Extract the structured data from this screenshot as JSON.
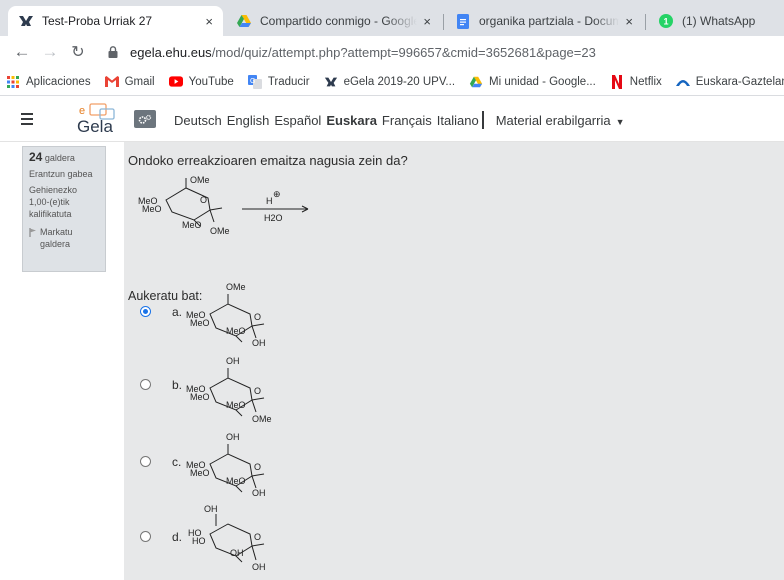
{
  "browser": {
    "tabs": [
      {
        "title": "Test-Proba Urriak 27",
        "close": "×"
      },
      {
        "title": "Compartido conmigo - Google D",
        "close": "×"
      },
      {
        "title": "organika partziala - Documentos",
        "close": "×"
      },
      {
        "title": "(1) WhatsApp",
        "badge": "1"
      }
    ],
    "url_host": "egela.ehu.eus",
    "url_path": "/mod/quiz/attempt.php?attempt=996657&cmid=3652681&page=23",
    "bookmarks": [
      {
        "label": "Aplicaciones",
        "icon": "apps-grid-icon"
      },
      {
        "label": "Gmail",
        "icon": "gmail-icon"
      },
      {
        "label": "YouTube",
        "icon": "youtube-icon"
      },
      {
        "label": "Traducir",
        "icon": "translate-icon"
      },
      {
        "label": "eGela 2019-20 UPV...",
        "icon": "egela-icon"
      },
      {
        "label": "Mi unidad - Google...",
        "icon": "drive-icon"
      },
      {
        "label": "Netflix",
        "icon": "netflix-icon"
      },
      {
        "label": "Euskara-Gaztelania...",
        "icon": "euskara-icon"
      }
    ]
  },
  "navbar": {
    "logo_letter": "e",
    "logo_text": "Gela",
    "languages": [
      "Deutsch",
      "English",
      "Español",
      "Euskara",
      "Français",
      "Italiano"
    ],
    "current_language": "Euskara",
    "material_menu": "Material erabilgarria"
  },
  "question_info": {
    "number": "24",
    "number_label": "galdera",
    "status": "Erantzun gabea",
    "marks": "Gehienezko 1,00-(e)tik kalifikatuta",
    "flag_label": "Markatu galdera"
  },
  "question": {
    "text": "Ondoko erreakzioaren emaitza nagusia zein da?",
    "reaction": {
      "reagent_top": "H",
      "reagent_charge": "⊕",
      "reagent_bottom": "H2O",
      "substituents": {
        "top": "OMe",
        "left_upper": "MeO",
        "left_lower": "MeO",
        "ring": "MeO",
        "anomeric": "OMe"
      }
    },
    "prompt": "Aukeratu bat:",
    "options": [
      {
        "letter": "a.",
        "selected": true,
        "top": "OMe",
        "left_upper": "MeO",
        "left_lower": "MeO",
        "ring": "MeO",
        "anomeric": "OH"
      },
      {
        "letter": "b.",
        "selected": false,
        "top": "OH",
        "left_upper": "MeO",
        "left_lower": "MeO",
        "ring": "MeO",
        "anomeric": "OMe"
      },
      {
        "letter": "c.",
        "selected": false,
        "top": "OH",
        "left_upper": "MeO",
        "left_lower": "MeO",
        "ring": "MeO",
        "anomeric": "OH"
      },
      {
        "letter": "d.",
        "selected": false,
        "top": "OH",
        "left_upper": "HO",
        "left_lower": "HO",
        "ring": "OH",
        "anomeric": "OH"
      }
    ]
  },
  "colors": {
    "accent": "#1a73e8",
    "tab_strip": "#dee1e6",
    "content_bg": "#e7e8e9",
    "info_box": "#dee2e6"
  }
}
